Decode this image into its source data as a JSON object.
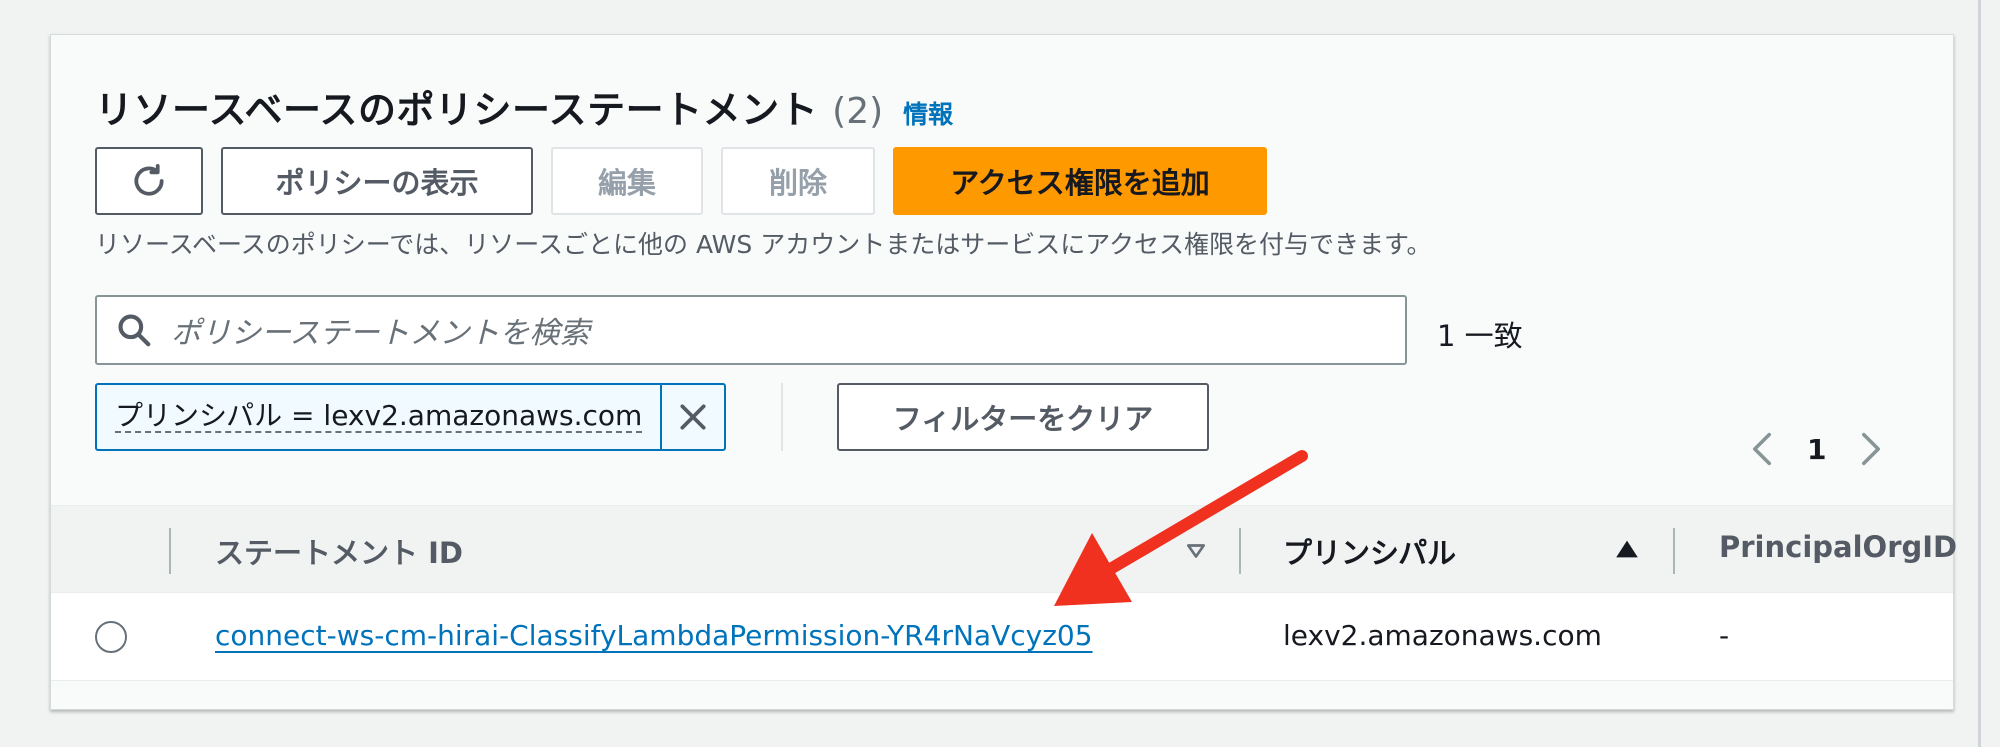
{
  "section": {
    "title": "リソースベースのポリシーステートメント",
    "count": "(2)",
    "info_link": "情報",
    "description": "リソースベースのポリシーでは、リソースごとに他の AWS アカウントまたはサービスにアクセス権限を付与できます。"
  },
  "toolbar": {
    "refresh_icon": "refresh-icon",
    "view_policy": "ポリシーの表示",
    "edit": "編集",
    "delete": "削除",
    "add_permission": "アクセス権限を追加"
  },
  "search": {
    "placeholder": "ポリシーステートメントを検索",
    "match_count": "1 一致"
  },
  "filter": {
    "token_label": "プリンシパル = lexv2.amazonaws.com",
    "clear_label": "フィルターをクリア"
  },
  "pagination": {
    "current_page": "1"
  },
  "table": {
    "columns": [
      "ステートメント ID",
      "プリンシパル",
      "PrincipalOrgID"
    ],
    "rows": [
      {
        "statement_id": "connect-ws-cm-hirai-ClassifyLambdaPermission-YR4rNaVcyz05",
        "principal": "lexv2.amazonaws.com",
        "principal_org_id": "-"
      }
    ]
  },
  "colors": {
    "primary_button": "#ff9900",
    "link": "#0073bb",
    "annotation_arrow": "#f0311f"
  }
}
